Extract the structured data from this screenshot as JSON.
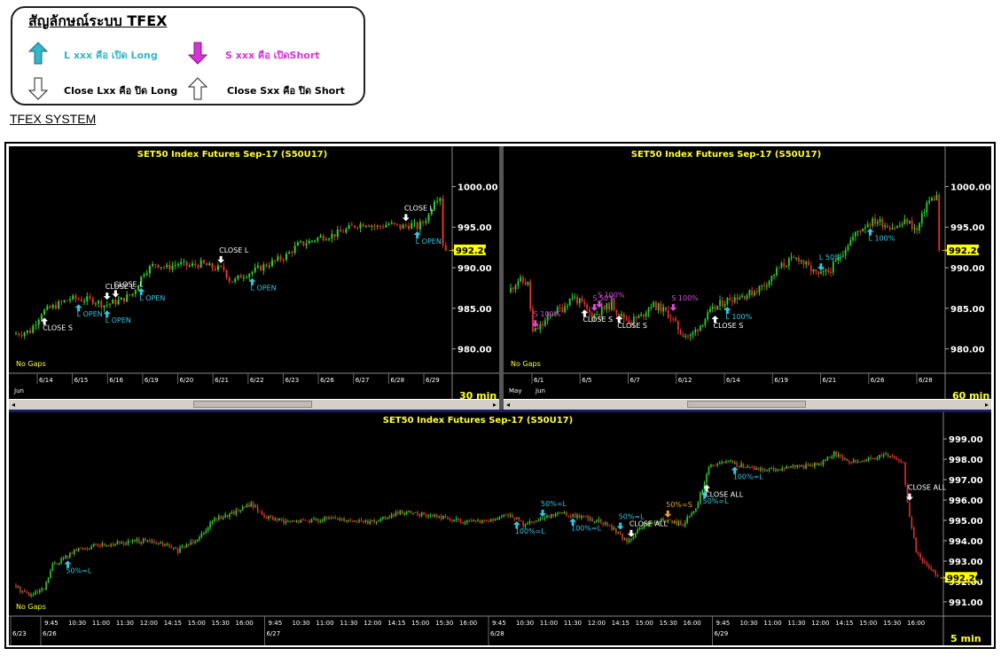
{
  "legend": {
    "title": "สัญลักษณ์ระบบ TFEX",
    "items": [
      {
        "text": "L xxx คือ เปิด Long",
        "color": "#33b6c9",
        "icon": "teal-up-arrow-icon"
      },
      {
        "text": "S xxx คือ เปิดShort",
        "color": "#d633d6",
        "icon": "magenta-down-arrow-icon"
      },
      {
        "text": "Close Lxx คือ ปิด Long",
        "color": "#000000",
        "icon": "outline-down-arrow-icon"
      },
      {
        "text": "Close Sxx คือ ปิด Short",
        "color": "#000000",
        "icon": "outline-up-arrow-icon"
      }
    ]
  },
  "section_title": "TFEX SYSTEM",
  "colors": {
    "up": "#2ecc2e",
    "down": "#e03030",
    "title": "#ffff33",
    "long": "#33c6e0",
    "short": "#d64dd6",
    "close": "#ffffff",
    "half_short": "#f0a020",
    "price_tag": "#ffff00"
  },
  "chart_data": [
    {
      "type": "candlestick",
      "title": "SET50  Index  Futures  Sep-17  (S50U17)",
      "timeframe": "30  min",
      "gaps_label": "No  Gaps",
      "ylim": [
        977,
        1003
      ],
      "y_ticks": [
        "1000.00",
        "995.00",
        "990.00",
        "985.00",
        "980.00"
      ],
      "y_tick_values": [
        1000,
        995,
        990,
        985,
        980
      ],
      "last_price": "992.20",
      "date_labels": [
        "6/14",
        "6/15",
        "6/16",
        "6/19",
        "6/20",
        "6/21",
        "6/22",
        "6/23",
        "6/26",
        "6/27",
        "6/28",
        "6/29"
      ],
      "month_labels": [
        "Jun"
      ],
      "path": [
        [
          0,
          981.8
        ],
        [
          6,
          982.2
        ],
        [
          10,
          984.5
        ],
        [
          16,
          985.5
        ],
        [
          20,
          986.2
        ],
        [
          28,
          986.0
        ],
        [
          32,
          985.4
        ],
        [
          38,
          986.0
        ],
        [
          42,
          986.8
        ],
        [
          46,
          989.5
        ],
        [
          50,
          990.5
        ],
        [
          54,
          990.0
        ],
        [
          58,
          990.5
        ],
        [
          62,
          990.2
        ],
        [
          66,
          990.5
        ],
        [
          70,
          990.0
        ],
        [
          74,
          989.8
        ],
        [
          76,
          988.5
        ],
        [
          78,
          988.4
        ],
        [
          80,
          989.0
        ],
        [
          84,
          989.5
        ],
        [
          88,
          990.2
        ],
        [
          92,
          990.8
        ],
        [
          96,
          991.5
        ],
        [
          100,
          992.8
        ],
        [
          104,
          993.2
        ],
        [
          108,
          993.8
        ],
        [
          112,
          994.0
        ],
        [
          116,
          994.5
        ],
        [
          120,
          995.2
        ],
        [
          124,
          995.5
        ],
        [
          128,
          995.0
        ],
        [
          132,
          995.4
        ],
        [
          136,
          995.0
        ],
        [
          140,
          995.3
        ],
        [
          142,
          995.0
        ],
        [
          144,
          995.6
        ],
        [
          146,
          996.5
        ],
        [
          148,
          998.5
        ],
        [
          150,
          998.8
        ],
        [
          151,
          993.0
        ],
        [
          152,
          992.2
        ]
      ],
      "n": 152,
      "markers": [
        {
          "i": 10,
          "kind": "close_short",
          "label": "CLOSE  S",
          "dir": "up"
        },
        {
          "i": 22,
          "kind": "long",
          "label": "L  OPEN",
          "dir": "up"
        },
        {
          "i": 32,
          "kind": "long",
          "label": "L  OPEN",
          "dir": "up"
        },
        {
          "i": 32,
          "kind": "close_long",
          "label": "CLOSE  L",
          "dir": "down"
        },
        {
          "i": 35,
          "kind": "close_long",
          "label": "CLOSE  L",
          "dir": "down"
        },
        {
          "i": 44,
          "kind": "long",
          "label": "L  OPEN",
          "dir": "up"
        },
        {
          "i": 72,
          "kind": "close_long",
          "label": "CLOSE  L",
          "dir": "down"
        },
        {
          "i": 83,
          "kind": "long",
          "label": "L  OPEN",
          "dir": "up"
        },
        {
          "i": 137,
          "kind": "close_long",
          "label": "CLOSE  L",
          "dir": "down"
        },
        {
          "i": 141,
          "kind": "long",
          "label": "L  OPEN",
          "dir": "up"
        }
      ]
    },
    {
      "type": "candlestick",
      "title": "SET50  Index  Futures  Sep-17  (S50U17)",
      "timeframe": "60  min",
      "gaps_label": "No  Gaps",
      "ylim": [
        977,
        1003
      ],
      "y_ticks": [
        "1000.00",
        "995.00",
        "990.00",
        "985.00",
        "980.00"
      ],
      "y_tick_values": [
        1000,
        995,
        990,
        985,
        980
      ],
      "last_price": "992.20",
      "date_labels": [
        "6/1",
        "6/5",
        "6/7",
        "6/12",
        "6/14",
        "6/19",
        "6/21",
        "6/26",
        "6/28"
      ],
      "month_labels": [
        "May",
        "Jun"
      ],
      "path": [
        [
          0,
          987.0
        ],
        [
          4,
          988.5
        ],
        [
          8,
          988.0
        ],
        [
          10,
          982.0
        ],
        [
          14,
          983.0
        ],
        [
          18,
          984.5
        ],
        [
          22,
          985.0
        ],
        [
          26,
          986.5
        ],
        [
          30,
          985.5
        ],
        [
          34,
          984.0
        ],
        [
          38,
          984.8
        ],
        [
          42,
          985.5
        ],
        [
          46,
          984.0
        ],
        [
          50,
          983.5
        ],
        [
          54,
          984.0
        ],
        [
          58,
          985.5
        ],
        [
          62,
          985.0
        ],
        [
          66,
          984.0
        ],
        [
          70,
          982.0
        ],
        [
          74,
          981.5
        ],
        [
          78,
          983.0
        ],
        [
          82,
          984.5
        ],
        [
          86,
          985.5
        ],
        [
          90,
          986.2
        ],
        [
          94,
          986.5
        ],
        [
          98,
          986.8
        ],
        [
          102,
          987.5
        ],
        [
          106,
          988.5
        ],
        [
          110,
          990.0
        ],
        [
          114,
          990.8
        ],
        [
          118,
          991.2
        ],
        [
          122,
          990.0
        ],
        [
          126,
          989.0
        ],
        [
          130,
          989.5
        ],
        [
          134,
          991.0
        ],
        [
          138,
          993.0
        ],
        [
          142,
          994.5
        ],
        [
          146,
          995.5
        ],
        [
          150,
          995.8
        ],
        [
          154,
          995.2
        ],
        [
          158,
          995.0
        ],
        [
          162,
          995.8
        ],
        [
          166,
          994.5
        ],
        [
          170,
          998.0
        ],
        [
          174,
          998.8
        ],
        [
          175,
          992.2
        ]
      ],
      "n": 175,
      "markers": [
        {
          "i": 10,
          "kind": "short",
          "label": "S  100%",
          "dir": "down"
        },
        {
          "i": 34,
          "kind": "short",
          "label": "S  50%",
          "dir": "down"
        },
        {
          "i": 36,
          "kind": "short",
          "label": "S  100%",
          "dir": "down"
        },
        {
          "i": 30,
          "kind": "close_short",
          "label": "CLOSE  S",
          "dir": "up"
        },
        {
          "i": 44,
          "kind": "close_short",
          "label": "CLOSE  S",
          "dir": "up"
        },
        {
          "i": 66,
          "kind": "short",
          "label": "S  100%",
          "dir": "down"
        },
        {
          "i": 83,
          "kind": "close_short",
          "label": "CLOSE  S",
          "dir": "up"
        },
        {
          "i": 88,
          "kind": "long",
          "label": "L  100%",
          "dir": "up"
        },
        {
          "i": 126,
          "kind": "long",
          "label": "L  50%",
          "dir": "down"
        },
        {
          "i": 146,
          "kind": "long",
          "label": "L  100%",
          "dir": "up"
        }
      ]
    },
    {
      "type": "candlestick",
      "title": "SET50  Index  Futures  Sep-17  (S50U17)",
      "timeframe": "5  min",
      "gaps_label": "No  Gaps",
      "ylim": [
        990.3,
        999.7
      ],
      "y_ticks": [
        "999.00",
        "998.00",
        "997.00",
        "996.00",
        "995.00",
        "994.00",
        "993.00",
        "992.00",
        "991.00"
      ],
      "y_tick_values": [
        999,
        998,
        997,
        996,
        995,
        994,
        993,
        992,
        991
      ],
      "last_price": "992.20",
      "time_labels": [
        "9:45",
        "10:30",
        "11:00",
        "11:30",
        "12:00",
        "14:15",
        "15:00",
        "15:30",
        "16:00",
        "9:45",
        "10:30",
        "11:00",
        "11:30",
        "12:00",
        "14:15",
        "15:00",
        "15:30",
        "16:00",
        "9:45",
        "10:30",
        "11:00",
        "11:30",
        "12:00",
        "14:15",
        "15:00",
        "15:30",
        "16:00",
        "9:45",
        "10:30",
        "11:00",
        "11:30",
        "12:00",
        "14:15",
        "15:00",
        "15:30",
        "16:00"
      ],
      "date_labels": [
        "6/23",
        "6/26",
        "6/27",
        "6/28",
        "6/29"
      ],
      "path": [
        [
          0,
          991.8
        ],
        [
          8,
          991.3
        ],
        [
          14,
          991.6
        ],
        [
          18,
          992.8
        ],
        [
          24,
          993.2
        ],
        [
          30,
          993.6
        ],
        [
          40,
          993.8
        ],
        [
          60,
          994.0
        ],
        [
          70,
          993.8
        ],
        [
          76,
          993.5
        ],
        [
          80,
          993.8
        ],
        [
          86,
          994.2
        ],
        [
          92,
          995.0
        ],
        [
          100,
          995.3
        ],
        [
          110,
          995.8
        ],
        [
          116,
          995.2
        ],
        [
          126,
          994.9
        ],
        [
          136,
          995.0
        ],
        [
          150,
          995.1
        ],
        [
          166,
          994.9
        ],
        [
          180,
          995.4
        ],
        [
          196,
          995.2
        ],
        [
          210,
          994.9
        ],
        [
          222,
          995.0
        ],
        [
          230,
          995.3
        ],
        [
          236,
          994.8
        ],
        [
          244,
          995.0
        ],
        [
          252,
          995.4
        ],
        [
          262,
          995.2
        ],
        [
          270,
          995.0
        ],
        [
          278,
          994.6
        ],
        [
          284,
          993.9
        ],
        [
          292,
          994.8
        ],
        [
          300,
          995.0
        ],
        [
          310,
          994.8
        ],
        [
          316,
          995.6
        ],
        [
          322,
          997.6
        ],
        [
          330,
          997.9
        ],
        [
          340,
          997.6
        ],
        [
          352,
          997.5
        ],
        [
          362,
          997.6
        ],
        [
          374,
          997.8
        ],
        [
          380,
          998.3
        ],
        [
          386,
          997.9
        ],
        [
          396,
          998.0
        ],
        [
          406,
          998.2
        ],
        [
          412,
          997.9
        ],
        [
          414,
          995.8
        ],
        [
          418,
          993.5
        ],
        [
          424,
          992.6
        ],
        [
          428,
          992.3
        ]
      ],
      "n": 428,
      "markers": [
        {
          "i": 24,
          "kind": "long",
          "label": "50%=L",
          "dir": "up"
        },
        {
          "i": 232,
          "kind": "long",
          "label": "100%=L",
          "dir": "up"
        },
        {
          "i": 244,
          "kind": "long",
          "label": "50%=L",
          "dir": "down"
        },
        {
          "i": 258,
          "kind": "long",
          "label": "100%=L",
          "dir": "up"
        },
        {
          "i": 280,
          "kind": "long",
          "label": "50%=L",
          "dir": "down"
        },
        {
          "i": 285,
          "kind": "close_long",
          "label": "CLOSE  ALL",
          "dir": "down"
        },
        {
          "i": 302,
          "kind": "half_short",
          "label": "50%=S",
          "dir": "down"
        },
        {
          "i": 319,
          "kind": "long",
          "label": "50%=L",
          "dir": "up"
        },
        {
          "i": 320,
          "kind": "close_long",
          "label": "CLOSE  ALL",
          "dir": "up"
        },
        {
          "i": 333,
          "kind": "long",
          "label": "100%=L",
          "dir": "up"
        },
        {
          "i": 414,
          "kind": "close_long",
          "label": "CLOSE  ALL",
          "dir": "down"
        }
      ]
    }
  ]
}
